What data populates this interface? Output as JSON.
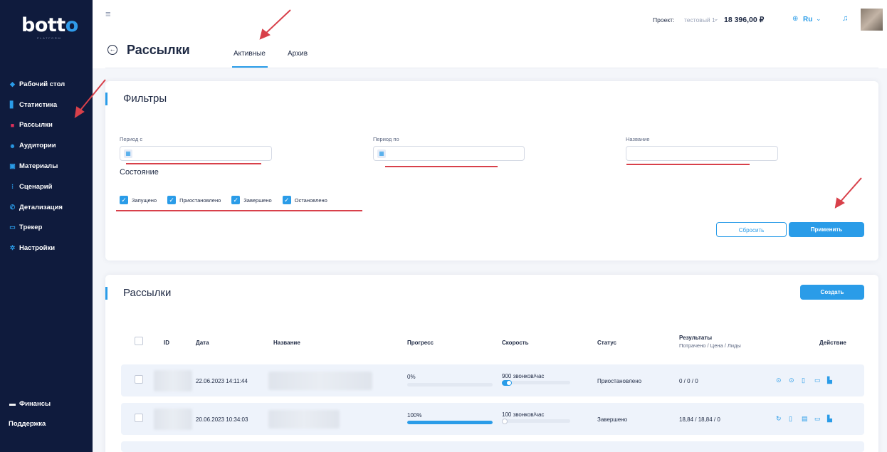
{
  "sidebar": {
    "logo": {
      "main": "bott",
      "accent": "o",
      "sub": "PLATFORM"
    },
    "items": [
      {
        "label": "Рабочий стол",
        "icon": "layers-icon"
      },
      {
        "label": "Статистика",
        "icon": "stats-icon"
      },
      {
        "label": "Рассылки",
        "icon": "mail-icon"
      },
      {
        "label": "Аудитории",
        "icon": "audience-icon"
      },
      {
        "label": "Материалы",
        "icon": "materials-icon"
      },
      {
        "label": "Сценарий",
        "icon": "scenario-icon"
      },
      {
        "label": "Детализация",
        "icon": "phone-icon"
      },
      {
        "label": "Трекер",
        "icon": "tracker-icon"
      },
      {
        "label": "Настройки",
        "icon": "gear-icon"
      }
    ],
    "bottom": [
      {
        "label": "Финансы",
        "icon": "wallet-icon"
      },
      {
        "label": "Поддержка"
      }
    ]
  },
  "topbar": {
    "project_label": "Проект:",
    "project_value": "тестовый 1",
    "balance": "18 396,00 ₽",
    "lang": "Ru"
  },
  "header": {
    "title": "Рассылки",
    "tabs": [
      "Активные",
      "Архив"
    ]
  },
  "filters": {
    "title": "Фильтры",
    "period_from_label": "Период с",
    "period_to_label": "Период по",
    "name_label": "Название",
    "period_from_value": "",
    "period_to_value": "",
    "name_value": "",
    "state_label": "Состояние",
    "states": [
      "Запущено",
      "Приостановлено",
      "Завершено",
      "Остановлено"
    ],
    "reset_label": "Сбросить",
    "apply_label": "Применить"
  },
  "mailings": {
    "title": "Рассылки",
    "create_label": "Создать",
    "columns": {
      "id": "ID",
      "date": "Дата",
      "name": "Название",
      "progress": "Прогресс",
      "speed": "Скорость",
      "status": "Статус",
      "results": "Результаты",
      "results_sub": "Потрачено / Цена / Лиды",
      "action": "Действие"
    },
    "rows": [
      {
        "date": "22.06.2023 14:11:44",
        "progress_label": "0%",
        "progress": 0,
        "speed": "900 звонков/час",
        "status": "Приостановлено",
        "results": "0 / 0 / 0"
      },
      {
        "date": "20.06.2023 10:34:03",
        "progress_label": "100%",
        "progress": 100,
        "speed": "100 звонков/час",
        "status": "Завершено",
        "results": "18,84 / 18,84 / 0"
      }
    ]
  },
  "colors": {
    "accent": "#2a9ce8",
    "sidebar": "#0f1b3d",
    "annotation": "#d8404a"
  }
}
